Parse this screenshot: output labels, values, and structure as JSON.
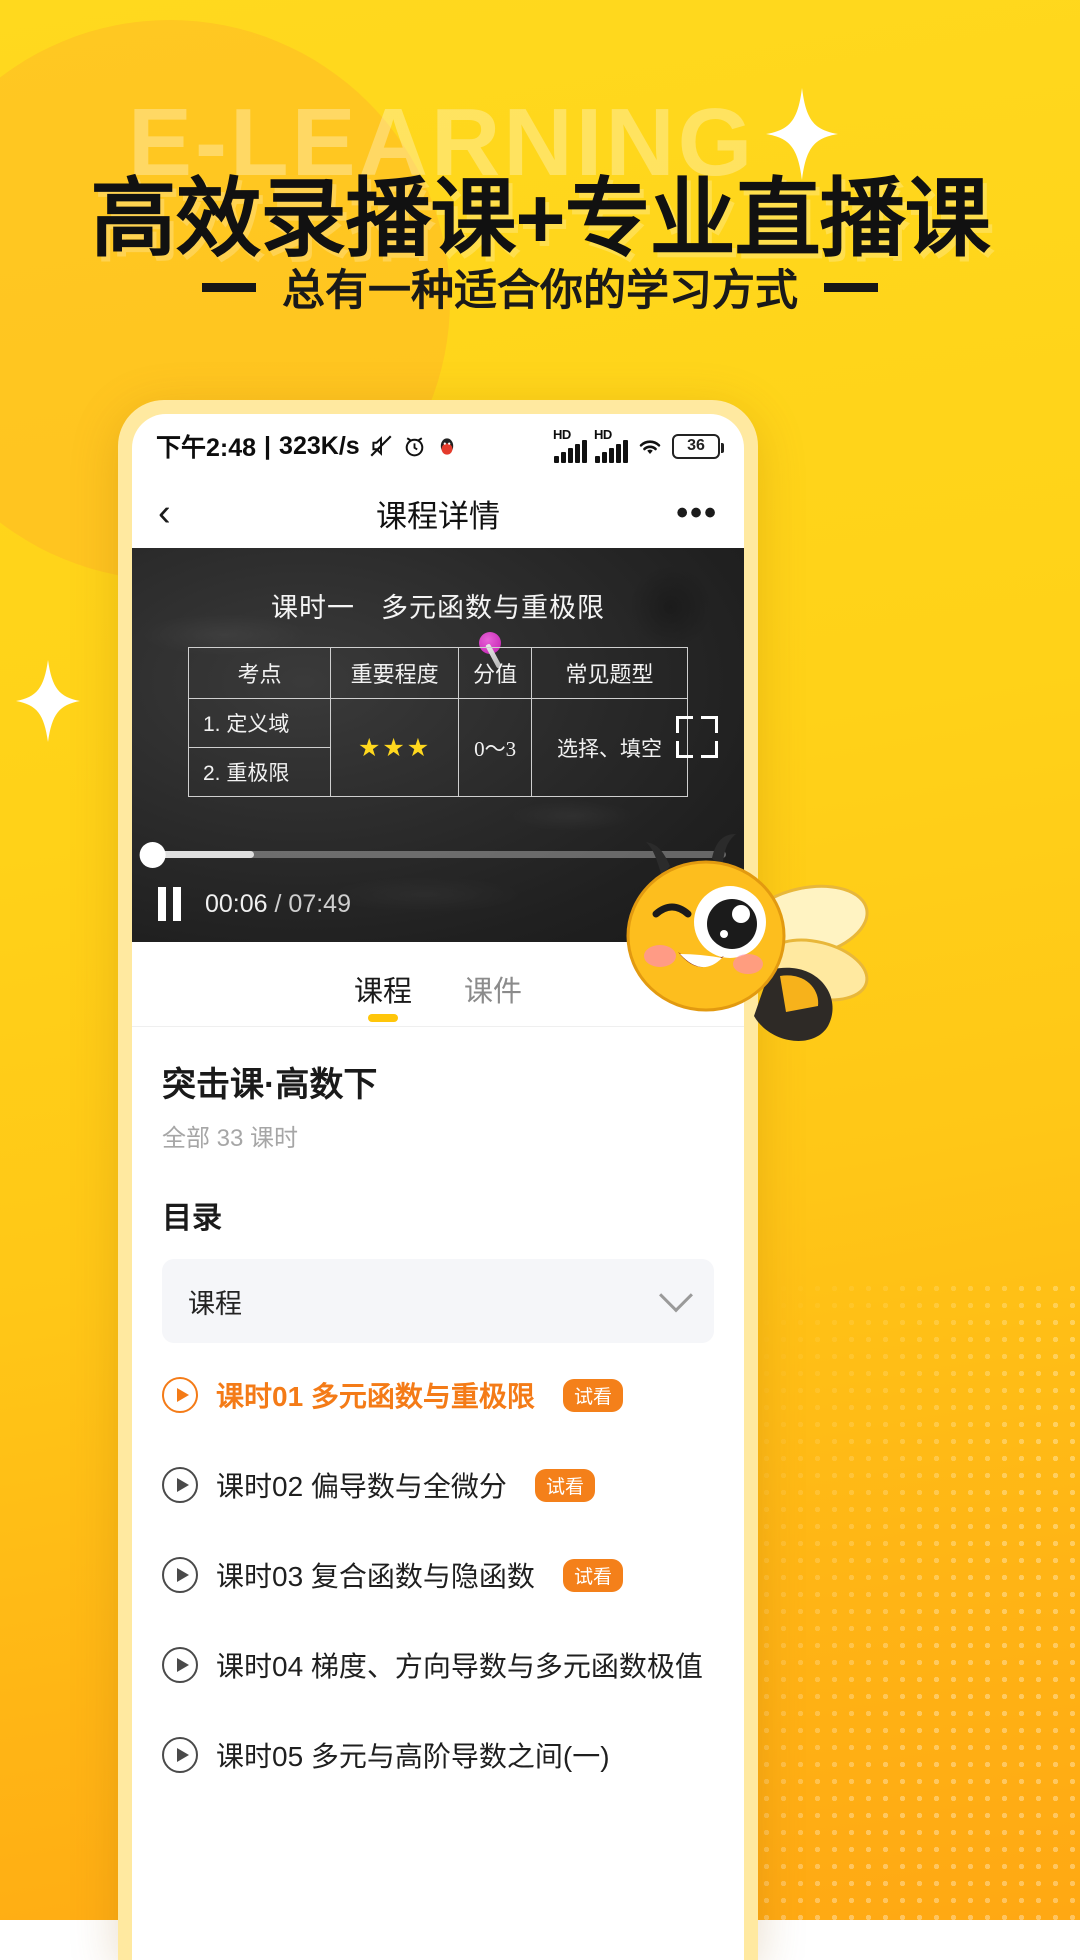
{
  "promo": {
    "ghost_word": "E-LEARNING",
    "headline": "高效录播课+专业直播课",
    "subtitle": "总有一种适合你的学习方式",
    "accent_color": "#FFD11A",
    "headline_color": "#111111"
  },
  "statusbar": {
    "time": "下午2:48",
    "separator": "|",
    "network_speed": "323K/s",
    "icons": [
      "mute-icon",
      "alarm-icon",
      "qq-icon",
      "hd-signal-icon",
      "hd-signal-icon",
      "wifi-icon"
    ],
    "battery_level": "36"
  },
  "appbar": {
    "back_icon": "back-chevron-icon",
    "title": "课程详情",
    "more_icon": "more-dots-icon"
  },
  "video": {
    "lesson_label": "课时一",
    "lesson_title": "多元函数与重极限",
    "board_table": {
      "headers": [
        "考点",
        "重要程度",
        "分值",
        "常见题型"
      ],
      "rows": [
        {
          "point": "1. 定义域"
        },
        {
          "point": "2. 重极限"
        }
      ],
      "importance": "★★★",
      "score": "0～3",
      "question_type": "选择、填空"
    },
    "fullscreen_icon": "fullscreen-icon",
    "pause_icon": "pause-icon",
    "settings_icon": "gear-icon",
    "current_time": "00:06",
    "time_divider": "/",
    "total_time": "07:49",
    "progress_percent": 18
  },
  "tabs": [
    {
      "label": "课程",
      "active": true
    },
    {
      "label": "课件",
      "active": false
    }
  ],
  "course": {
    "title": "突击课·高数下",
    "lesson_count_text": "全部 33 课时"
  },
  "catalog": {
    "heading": "目录",
    "group_label": "课程",
    "expand_icon": "chevron-down-icon",
    "lessons": [
      {
        "text": "课时01 多元函数与重极限",
        "badge": "试看",
        "active": true
      },
      {
        "text": "课时02 偏导数与全微分",
        "badge": "试看",
        "active": false
      },
      {
        "text": "课时03 复合函数与隐函数",
        "badge": "试看",
        "active": false
      },
      {
        "text": "课时04 梯度、方向导数与多元函数极值",
        "badge": "",
        "active": false
      },
      {
        "text": "课时05 多元与高阶导数之间(一)",
        "badge": "",
        "active": false
      }
    ]
  },
  "mascot": {
    "name": "bee-mascot"
  }
}
